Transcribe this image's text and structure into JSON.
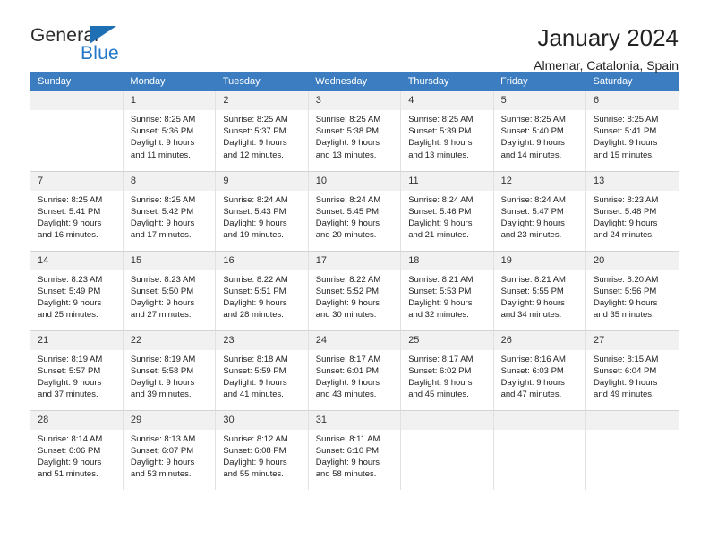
{
  "brand": {
    "name_part1": "General",
    "name_part2": "Blue",
    "triangle_color": "#1f6fb5",
    "blue_color": "#2277c8"
  },
  "header": {
    "title": "January 2024",
    "subtitle": "Almenar, Catalonia, Spain"
  },
  "theme": {
    "header_row_bg": "#3b7dc0",
    "daynum_bg": "#f1f1f1",
    "cell_border": "#d3d3d3"
  },
  "weekdays": [
    "Sunday",
    "Monday",
    "Tuesday",
    "Wednesday",
    "Thursday",
    "Friday",
    "Saturday"
  ],
  "labels": {
    "sunrise": "Sunrise:",
    "sunset": "Sunset:",
    "daylight": "Daylight:"
  },
  "weeks": [
    [
      {
        "empty": true
      },
      {
        "day": "1",
        "sunrise": "Sunrise: 8:25 AM",
        "sunset": "Sunset: 5:36 PM",
        "daylight_line1": "Daylight: 9 hours",
        "daylight_line2": "and 11 minutes."
      },
      {
        "day": "2",
        "sunrise": "Sunrise: 8:25 AM",
        "sunset": "Sunset: 5:37 PM",
        "daylight_line1": "Daylight: 9 hours",
        "daylight_line2": "and 12 minutes."
      },
      {
        "day": "3",
        "sunrise": "Sunrise: 8:25 AM",
        "sunset": "Sunset: 5:38 PM",
        "daylight_line1": "Daylight: 9 hours",
        "daylight_line2": "and 13 minutes."
      },
      {
        "day": "4",
        "sunrise": "Sunrise: 8:25 AM",
        "sunset": "Sunset: 5:39 PM",
        "daylight_line1": "Daylight: 9 hours",
        "daylight_line2": "and 13 minutes."
      },
      {
        "day": "5",
        "sunrise": "Sunrise: 8:25 AM",
        "sunset": "Sunset: 5:40 PM",
        "daylight_line1": "Daylight: 9 hours",
        "daylight_line2": "and 14 minutes."
      },
      {
        "day": "6",
        "sunrise": "Sunrise: 8:25 AM",
        "sunset": "Sunset: 5:41 PM",
        "daylight_line1": "Daylight: 9 hours",
        "daylight_line2": "and 15 minutes."
      }
    ],
    [
      {
        "day": "7",
        "sunrise": "Sunrise: 8:25 AM",
        "sunset": "Sunset: 5:41 PM",
        "daylight_line1": "Daylight: 9 hours",
        "daylight_line2": "and 16 minutes."
      },
      {
        "day": "8",
        "sunrise": "Sunrise: 8:25 AM",
        "sunset": "Sunset: 5:42 PM",
        "daylight_line1": "Daylight: 9 hours",
        "daylight_line2": "and 17 minutes."
      },
      {
        "day": "9",
        "sunrise": "Sunrise: 8:24 AM",
        "sunset": "Sunset: 5:43 PM",
        "daylight_line1": "Daylight: 9 hours",
        "daylight_line2": "and 19 minutes."
      },
      {
        "day": "10",
        "sunrise": "Sunrise: 8:24 AM",
        "sunset": "Sunset: 5:45 PM",
        "daylight_line1": "Daylight: 9 hours",
        "daylight_line2": "and 20 minutes."
      },
      {
        "day": "11",
        "sunrise": "Sunrise: 8:24 AM",
        "sunset": "Sunset: 5:46 PM",
        "daylight_line1": "Daylight: 9 hours",
        "daylight_line2": "and 21 minutes."
      },
      {
        "day": "12",
        "sunrise": "Sunrise: 8:24 AM",
        "sunset": "Sunset: 5:47 PM",
        "daylight_line1": "Daylight: 9 hours",
        "daylight_line2": "and 23 minutes."
      },
      {
        "day": "13",
        "sunrise": "Sunrise: 8:23 AM",
        "sunset": "Sunset: 5:48 PM",
        "daylight_line1": "Daylight: 9 hours",
        "daylight_line2": "and 24 minutes."
      }
    ],
    [
      {
        "day": "14",
        "sunrise": "Sunrise: 8:23 AM",
        "sunset": "Sunset: 5:49 PM",
        "daylight_line1": "Daylight: 9 hours",
        "daylight_line2": "and 25 minutes."
      },
      {
        "day": "15",
        "sunrise": "Sunrise: 8:23 AM",
        "sunset": "Sunset: 5:50 PM",
        "daylight_line1": "Daylight: 9 hours",
        "daylight_line2": "and 27 minutes."
      },
      {
        "day": "16",
        "sunrise": "Sunrise: 8:22 AM",
        "sunset": "Sunset: 5:51 PM",
        "daylight_line1": "Daylight: 9 hours",
        "daylight_line2": "and 28 minutes."
      },
      {
        "day": "17",
        "sunrise": "Sunrise: 8:22 AM",
        "sunset": "Sunset: 5:52 PM",
        "daylight_line1": "Daylight: 9 hours",
        "daylight_line2": "and 30 minutes."
      },
      {
        "day": "18",
        "sunrise": "Sunrise: 8:21 AM",
        "sunset": "Sunset: 5:53 PM",
        "daylight_line1": "Daylight: 9 hours",
        "daylight_line2": "and 32 minutes."
      },
      {
        "day": "19",
        "sunrise": "Sunrise: 8:21 AM",
        "sunset": "Sunset: 5:55 PM",
        "daylight_line1": "Daylight: 9 hours",
        "daylight_line2": "and 34 minutes."
      },
      {
        "day": "20",
        "sunrise": "Sunrise: 8:20 AM",
        "sunset": "Sunset: 5:56 PM",
        "daylight_line1": "Daylight: 9 hours",
        "daylight_line2": "and 35 minutes."
      }
    ],
    [
      {
        "day": "21",
        "sunrise": "Sunrise: 8:19 AM",
        "sunset": "Sunset: 5:57 PM",
        "daylight_line1": "Daylight: 9 hours",
        "daylight_line2": "and 37 minutes."
      },
      {
        "day": "22",
        "sunrise": "Sunrise: 8:19 AM",
        "sunset": "Sunset: 5:58 PM",
        "daylight_line1": "Daylight: 9 hours",
        "daylight_line2": "and 39 minutes."
      },
      {
        "day": "23",
        "sunrise": "Sunrise: 8:18 AM",
        "sunset": "Sunset: 5:59 PM",
        "daylight_line1": "Daylight: 9 hours",
        "daylight_line2": "and 41 minutes."
      },
      {
        "day": "24",
        "sunrise": "Sunrise: 8:17 AM",
        "sunset": "Sunset: 6:01 PM",
        "daylight_line1": "Daylight: 9 hours",
        "daylight_line2": "and 43 minutes."
      },
      {
        "day": "25",
        "sunrise": "Sunrise: 8:17 AM",
        "sunset": "Sunset: 6:02 PM",
        "daylight_line1": "Daylight: 9 hours",
        "daylight_line2": "and 45 minutes."
      },
      {
        "day": "26",
        "sunrise": "Sunrise: 8:16 AM",
        "sunset": "Sunset: 6:03 PM",
        "daylight_line1": "Daylight: 9 hours",
        "daylight_line2": "and 47 minutes."
      },
      {
        "day": "27",
        "sunrise": "Sunrise: 8:15 AM",
        "sunset": "Sunset: 6:04 PM",
        "daylight_line1": "Daylight: 9 hours",
        "daylight_line2": "and 49 minutes."
      }
    ],
    [
      {
        "day": "28",
        "sunrise": "Sunrise: 8:14 AM",
        "sunset": "Sunset: 6:06 PM",
        "daylight_line1": "Daylight: 9 hours",
        "daylight_line2": "and 51 minutes."
      },
      {
        "day": "29",
        "sunrise": "Sunrise: 8:13 AM",
        "sunset": "Sunset: 6:07 PM",
        "daylight_line1": "Daylight: 9 hours",
        "daylight_line2": "and 53 minutes."
      },
      {
        "day": "30",
        "sunrise": "Sunrise: 8:12 AM",
        "sunset": "Sunset: 6:08 PM",
        "daylight_line1": "Daylight: 9 hours",
        "daylight_line2": "and 55 minutes."
      },
      {
        "day": "31",
        "sunrise": "Sunrise: 8:11 AM",
        "sunset": "Sunset: 6:10 PM",
        "daylight_line1": "Daylight: 9 hours",
        "daylight_line2": "and 58 minutes."
      },
      {
        "empty": true
      },
      {
        "empty": true
      },
      {
        "empty": true
      }
    ]
  ]
}
